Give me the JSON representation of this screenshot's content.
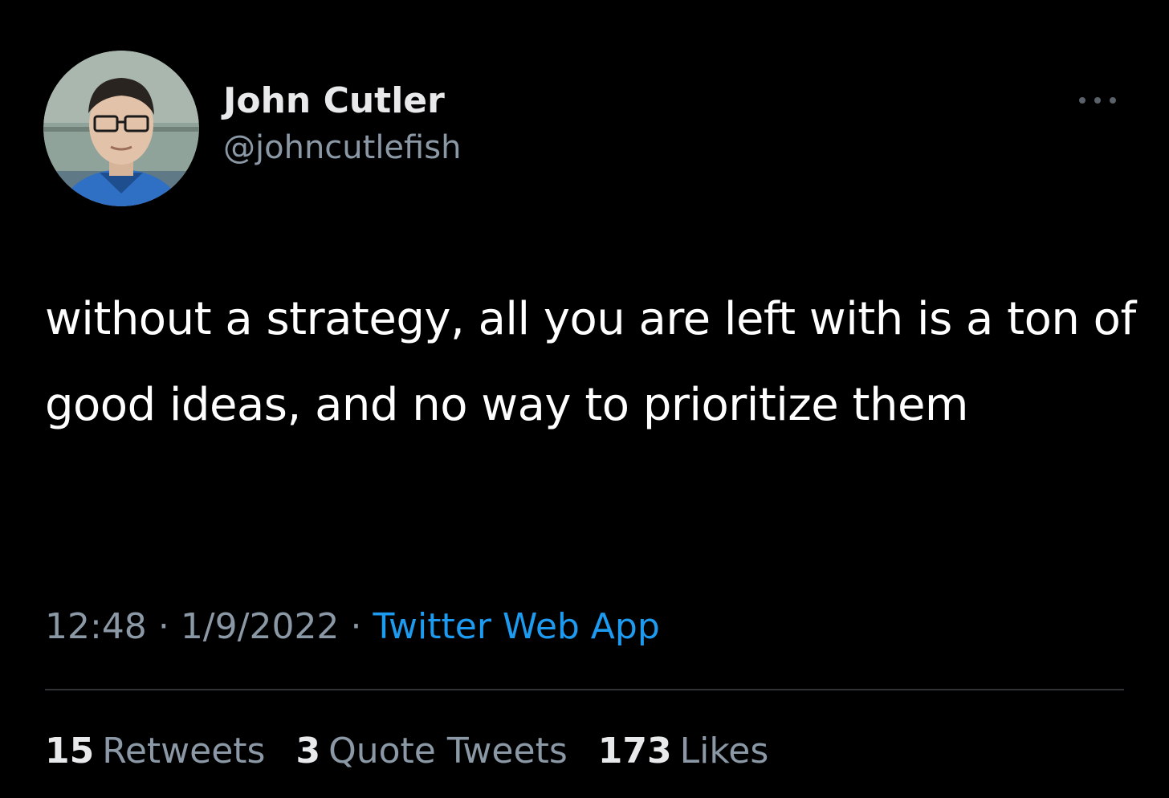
{
  "author": {
    "display_name": "John Cutler",
    "handle": "@johncutlefish"
  },
  "tweet": {
    "text": "without a strategy, all you are left with is a ton of good ideas, and no way to prioritize them"
  },
  "meta": {
    "time": "12:48",
    "separator1": "·",
    "date": "1/9/2022",
    "separator2": "·",
    "source": "Twitter Web App"
  },
  "stats": {
    "retweets_count": "15",
    "retweets_label": "Retweets",
    "quotes_count": "3",
    "quotes_label": "Quote Tweets",
    "likes_count": "173",
    "likes_label": "Likes"
  },
  "colors": {
    "background": "#000000",
    "text_primary": "#e7e9ea",
    "text_secondary": "#8b98a5",
    "link": "#1d9bf0",
    "divider": "#2f3336"
  },
  "icons": {
    "more": "more-horizontal-icon"
  }
}
